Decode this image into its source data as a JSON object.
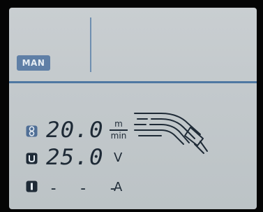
{
  "mode": {
    "label": "MAN"
  },
  "rows": [
    {
      "icon": "wire-spool-icon",
      "value": "20.0",
      "unit_top": "m",
      "unit_bottom": "min"
    },
    {
      "icon": "voltage-icon",
      "value": "25.0",
      "unit": "V"
    },
    {
      "icon": "current-icon",
      "value": "- - -",
      "unit": "A"
    }
  ],
  "colors": {
    "screen": "#c6cbce",
    "accent": "#4f78a2",
    "badge": "#5f7fa6",
    "segment": "#1e2a36"
  }
}
